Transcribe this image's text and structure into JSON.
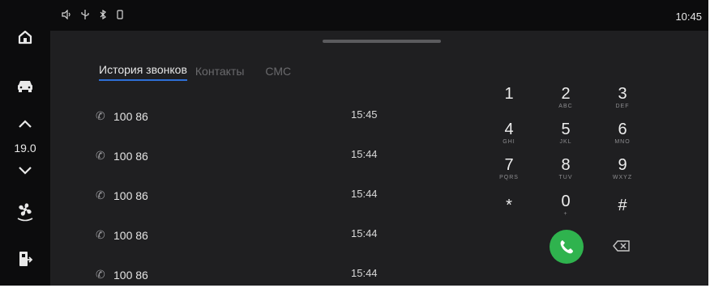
{
  "status_bar": {
    "icons": [
      "volume-icon",
      "usb-icon",
      "bluetooth-icon",
      "phone-icon"
    ],
    "time": "10:45"
  },
  "left_rail": {
    "temperature": "19.0",
    "icons": [
      "home-icon",
      "car-icon",
      "chevron-up-icon",
      "chevron-down-icon",
      "fan-icon",
      "exit-icon"
    ]
  },
  "tabs": [
    {
      "label": "История звонков",
      "active": true
    },
    {
      "label": "Контакты",
      "active": false
    },
    {
      "label": "СМС",
      "active": false
    }
  ],
  "calls": [
    {
      "number": "100 86",
      "time": "15:45"
    },
    {
      "number": "100 86",
      "time": "15:44"
    },
    {
      "number": "100 86",
      "time": "15:44"
    },
    {
      "number": "100 86",
      "time": "15:44"
    },
    {
      "number": "100 86",
      "time": "15:44"
    }
  ],
  "keypad": [
    {
      "digit": "1",
      "letters": ""
    },
    {
      "digit": "2",
      "letters": "ABC"
    },
    {
      "digit": "3",
      "letters": "DEF"
    },
    {
      "digit": "4",
      "letters": "GHI"
    },
    {
      "digit": "5",
      "letters": "JKL"
    },
    {
      "digit": "6",
      "letters": "MNO"
    },
    {
      "digit": "7",
      "letters": "PQRS"
    },
    {
      "digit": "8",
      "letters": "TUV"
    },
    {
      "digit": "9",
      "letters": "WXYZ"
    },
    {
      "digit": "*",
      "letters": ""
    },
    {
      "digit": "0",
      "letters": "+"
    },
    {
      "digit": "#",
      "letters": ""
    }
  ],
  "colors": {
    "accent": "#2e6fd6",
    "call_green": "#2fb34e"
  }
}
